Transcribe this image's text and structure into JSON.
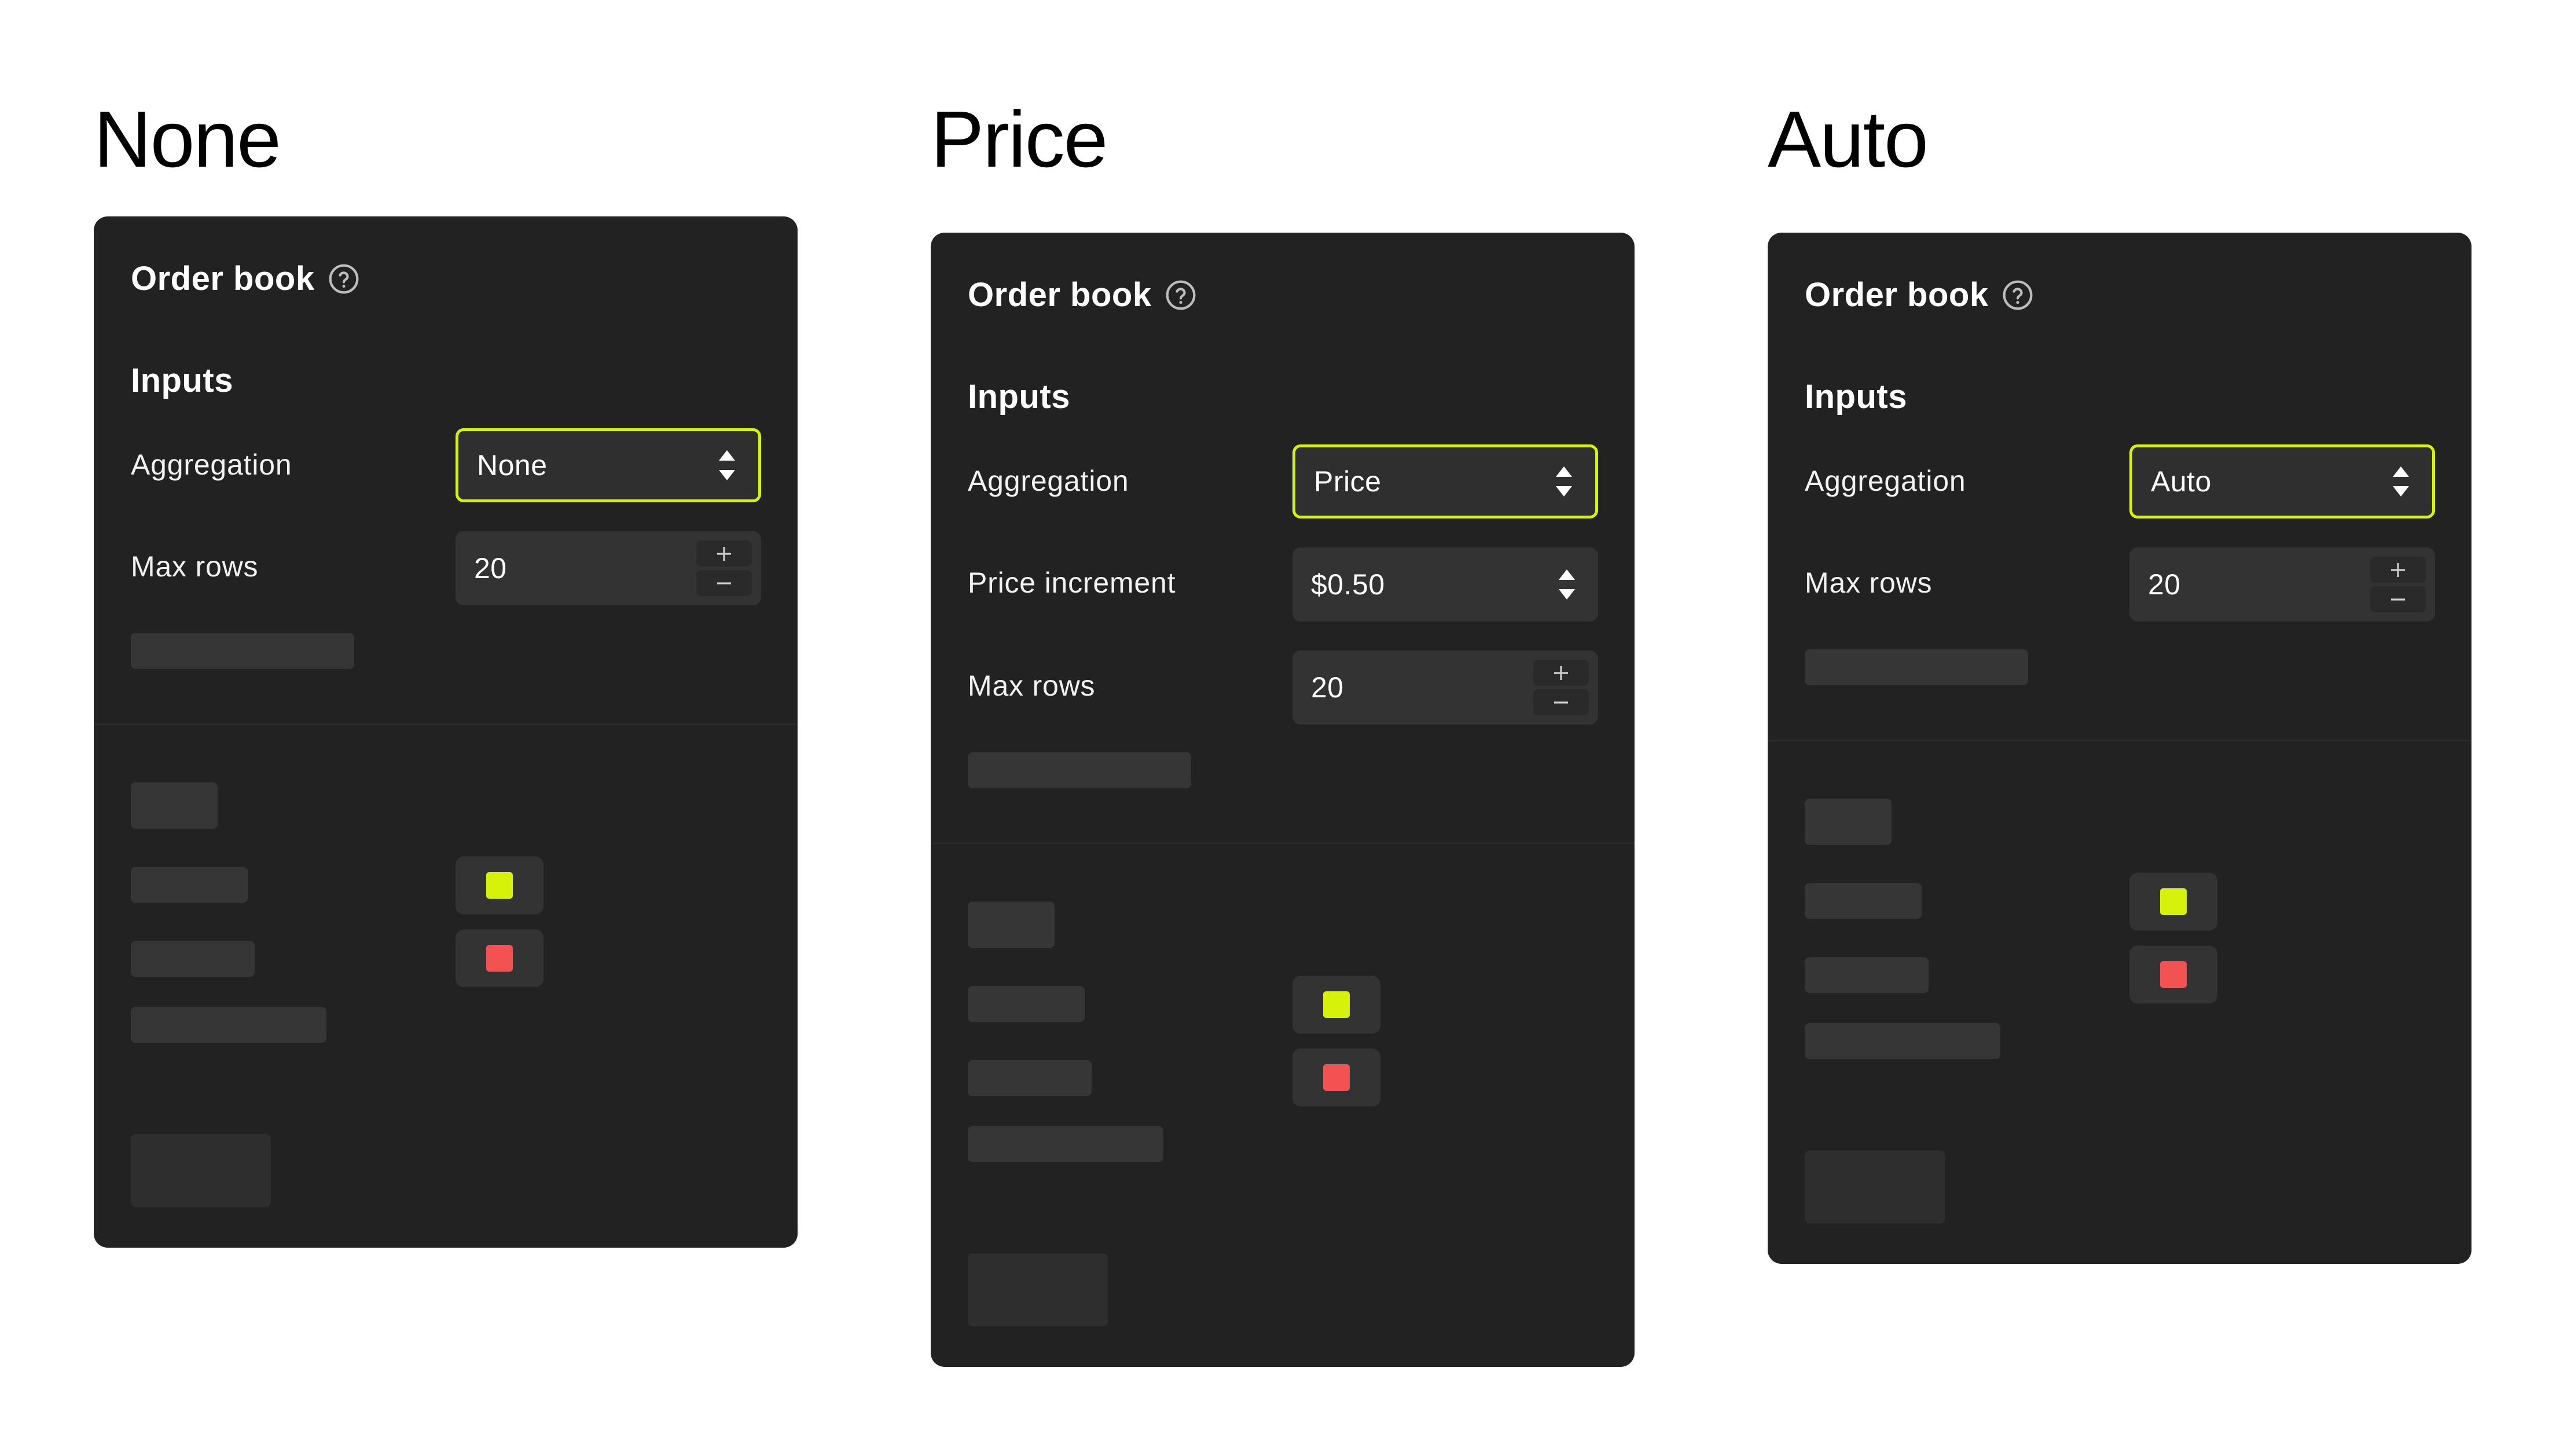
{
  "colors": {
    "accent": "#d7f20a",
    "bid": "#d7f20a",
    "ask": "#f25252",
    "card_bg": "#222222"
  },
  "columns": [
    {
      "heading": "None",
      "panel": {
        "title": "Order book",
        "help_icon": "question-circle-icon",
        "section": "Inputs",
        "aggregation": {
          "label": "Aggregation",
          "value": "None"
        },
        "max_rows": {
          "label": "Max rows",
          "value": "20"
        }
      }
    },
    {
      "heading": "Price",
      "panel": {
        "title": "Order book",
        "help_icon": "question-circle-icon",
        "section": "Inputs",
        "aggregation": {
          "label": "Aggregation",
          "value": "Price"
        },
        "price_increment": {
          "label": "Price increment",
          "value": "$0.50"
        },
        "max_rows": {
          "label": "Max rows",
          "value": "20"
        }
      }
    },
    {
      "heading": "Auto",
      "panel": {
        "title": "Order book",
        "help_icon": "question-circle-icon",
        "section": "Inputs",
        "aggregation": {
          "label": "Aggregation",
          "value": "Auto"
        },
        "max_rows": {
          "label": "Max rows",
          "value": "20"
        }
      }
    }
  ]
}
